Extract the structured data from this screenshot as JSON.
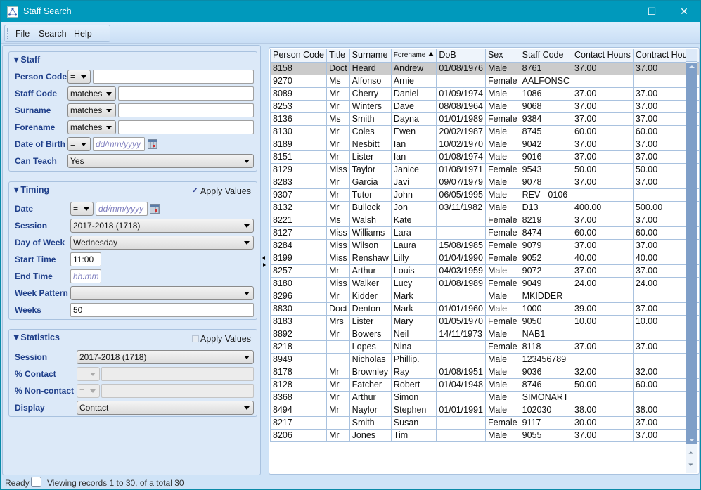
{
  "window": {
    "title": "Staff Search",
    "controls": {
      "minimize": "—",
      "maximize": "☐",
      "close": "✕"
    }
  },
  "menu": {
    "items": [
      {
        "label": "File"
      },
      {
        "label": "Search"
      },
      {
        "label": "Help"
      }
    ]
  },
  "staff_group": {
    "title": "▼Staff",
    "fields": {
      "person_code": {
        "label": "Person Code",
        "operator": "=",
        "value": ""
      },
      "staff_code": {
        "label": "Staff Code",
        "operator": "matches",
        "value": ""
      },
      "surname": {
        "label": "Surname",
        "operator": "matches",
        "value": ""
      },
      "forename": {
        "label": "Forename",
        "operator": "matches",
        "value": ""
      },
      "dob": {
        "label": "Date of Birth",
        "operator": "=",
        "placeholder": "dd/mm/yyyy"
      },
      "can_teach": {
        "label": "Can Teach",
        "value": "Yes"
      }
    }
  },
  "timing_group": {
    "title": "▼Timing",
    "apply_values": {
      "label": "Apply Values",
      "checked": true,
      "mark": "✔"
    },
    "fields": {
      "date": {
        "label": "Date",
        "operator": "=",
        "placeholder": "dd/mm/yyyy"
      },
      "session": {
        "label": "Session",
        "value": "2017-2018 (1718)"
      },
      "day_of_week": {
        "label": "Day of Week",
        "value": "Wednesday"
      },
      "start_time": {
        "label": "Start Time",
        "value": "11:00"
      },
      "end_time": {
        "label": "End Time",
        "placeholder": "hh:mm"
      },
      "week_pattern": {
        "label": "Week Pattern",
        "value": ""
      },
      "weeks": {
        "label": "Weeks",
        "value": "50"
      }
    }
  },
  "statistics_group": {
    "title": "▼Statistics",
    "apply_values": {
      "label": "Apply Values",
      "checked": false
    },
    "fields": {
      "session": {
        "label": "Session",
        "value": "2017-2018 (1718)"
      },
      "pct_contact": {
        "label": "% Contact",
        "operator": "=",
        "value": ""
      },
      "pct_non_contact": {
        "label": "% Non-contact",
        "operator": "=",
        "value": ""
      },
      "display": {
        "label": "Display",
        "value": "Contact"
      }
    }
  },
  "grid": {
    "columns": [
      "Person Code",
      "Title",
      "Surname",
      "Forename",
      "DoB",
      "Sex",
      "Staff Code",
      "Contact Hours",
      "Contract Hours"
    ],
    "sorted_column": "Forename",
    "sort_direction": "ascending",
    "selected_row": 0,
    "rows": [
      [
        "8158",
        "Doct",
        "Heard",
        "Andrew",
        "01/08/1976",
        "Male",
        "8761",
        "37.00",
        "37.00"
      ],
      [
        "9270",
        "Ms",
        "Alfonso",
        "Arnie",
        "",
        "Female",
        "AALFONSC",
        "",
        ""
      ],
      [
        "8089",
        "Mr",
        "Cherry",
        "Daniel",
        "01/09/1974",
        "Male",
        "1086",
        "37.00",
        "37.00"
      ],
      [
        "8253",
        "Mr",
        "Winters",
        "Dave",
        "08/08/1964",
        "Male",
        "9068",
        "37.00",
        "37.00"
      ],
      [
        "8136",
        "Ms",
        "Smith",
        "Dayna",
        "01/01/1989",
        "Female",
        "9384",
        "37.00",
        "37.00"
      ],
      [
        "8130",
        "Mr",
        "Coles",
        "Ewen",
        "20/02/1987",
        "Male",
        "8745",
        "60.00",
        "60.00"
      ],
      [
        "8189",
        "Mr",
        "Nesbitt",
        "Ian",
        "10/02/1970",
        "Male",
        "9042",
        "37.00",
        "37.00"
      ],
      [
        "8151",
        "Mr",
        "Lister",
        "Ian",
        "01/08/1974",
        "Male",
        "9016",
        "37.00",
        "37.00"
      ],
      [
        "8129",
        "Miss",
        "Taylor",
        "Janice",
        "01/08/1971",
        "Female",
        "9543",
        "50.00",
        "50.00"
      ],
      [
        "8283",
        "Mr",
        "Garcia",
        "Javi",
        "09/07/1979",
        "Male",
        "9078",
        "37.00",
        "37.00"
      ],
      [
        "9307",
        "Mr",
        "Tutor",
        "John",
        "06/05/1995",
        "Male",
        "REV - 0106",
        "",
        ""
      ],
      [
        "8132",
        "Mr",
        "Bullock",
        "Jon",
        "03/11/1982",
        "Male",
        "D13",
        "400.00",
        "500.00"
      ],
      [
        "8221",
        "Ms",
        "Walsh",
        "Kate",
        "",
        "Female",
        "8219",
        "37.00",
        "37.00"
      ],
      [
        "8127",
        "Miss",
        "Williams",
        "Lara",
        "",
        "Female",
        "8474",
        "60.00",
        "60.00"
      ],
      [
        "8284",
        "Miss",
        "Wilson",
        "Laura",
        "15/08/1985",
        "Female",
        "9079",
        "37.00",
        "37.00"
      ],
      [
        "8199",
        "Miss",
        "Renshaw",
        "Lilly",
        "01/04/1990",
        "Female",
        "9052",
        "40.00",
        "40.00"
      ],
      [
        "8257",
        "Mr",
        "Arthur",
        "Louis",
        "04/03/1959",
        "Male",
        "9072",
        "37.00",
        "37.00"
      ],
      [
        "8180",
        "Miss",
        "Walker",
        "Lucy",
        "01/08/1989",
        "Female",
        "9049",
        "24.00",
        "24.00"
      ],
      [
        "8296",
        "Mr",
        "Kidder",
        "Mark",
        "",
        "Male",
        "MKIDDER",
        "",
        ""
      ],
      [
        "8830",
        "Doct",
        "Denton",
        "Mark",
        "01/01/1960",
        "Male",
        "1000",
        "39.00",
        "37.00"
      ],
      [
        "8183",
        "Mrs",
        "Lister",
        "Mary",
        "01/05/1970",
        "Female",
        "9050",
        "10.00",
        "10.00"
      ],
      [
        "8892",
        "Mr",
        "Bowers",
        "Neil",
        "14/11/1973",
        "Male",
        "NAB1",
        "",
        ""
      ],
      [
        "8218",
        "",
        "Lopes",
        "Nina",
        "",
        "Female",
        "8118",
        "37.00",
        "37.00"
      ],
      [
        "8949",
        "",
        "Nicholas",
        "Phillip.",
        "",
        "Male",
        "123456789",
        "",
        ""
      ],
      [
        "8178",
        "Mr",
        "Brownley",
        "Ray",
        "01/08/1951",
        "Male",
        "9036",
        "32.00",
        "32.00"
      ],
      [
        "8128",
        "Mr",
        "Fatcher",
        "Robert",
        "01/04/1948",
        "Male",
        "8746",
        "50.00",
        "60.00"
      ],
      [
        "8368",
        "Mr",
        "Arthur",
        "Simon",
        "",
        "Male",
        "SIMONART",
        "",
        ""
      ],
      [
        "8494",
        "Mr",
        "Naylor",
        "Stephen",
        "01/01/1991",
        "Male",
        "102030",
        "38.00",
        "38.00"
      ],
      [
        "8217",
        "",
        "Smith",
        "Susan",
        "",
        "Female",
        "9117",
        "30.00",
        "37.00"
      ],
      [
        "8206",
        "Mr",
        "Jones",
        "Tim",
        "",
        "Male",
        "9055",
        "37.00",
        "37.00"
      ]
    ]
  },
  "statusbar": {
    "ready": "Ready",
    "records": "Viewing records 1 to 30, of a total 30"
  }
}
